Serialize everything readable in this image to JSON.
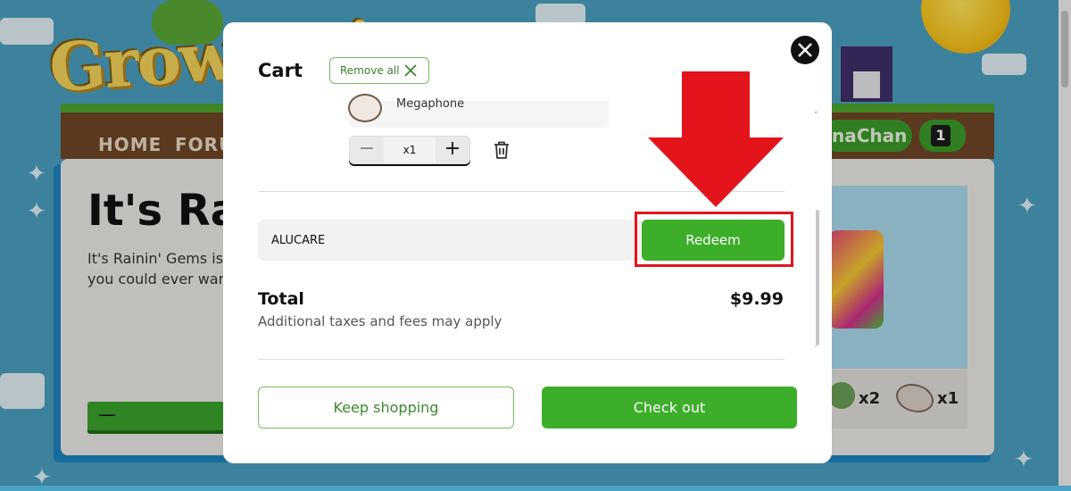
{
  "background": {
    "logo_text": "Growtopia",
    "nav": [
      "HOME",
      "FORU"
    ],
    "username_fragment": "naChan",
    "gem_count": "1",
    "headline": "It's Rai",
    "body_lines": [
      "It's Rainin' Gems is o",
      "you could ever want"
    ],
    "button_symbol": "—",
    "reward_quantities": [
      "x2",
      "x1"
    ]
  },
  "cart": {
    "title": "Cart",
    "remove_all_label": "Remove all",
    "item": {
      "name": "Megaphone",
      "quantity": "x1"
    },
    "promo_code_value": "ALUCARE",
    "redeem_label": "Redeem",
    "total_label": "Total",
    "total_price": "$9.99",
    "tax_note": "Additional taxes and fees may apply",
    "keep_shopping_label": "Keep shopping",
    "checkout_label": "Check out"
  },
  "annotation": {
    "arrow_color": "#e4141c",
    "highlight_color": "#e4141c"
  },
  "colors": {
    "primary_green": "#3cae2a",
    "outline_green": "#6fbf5f"
  }
}
